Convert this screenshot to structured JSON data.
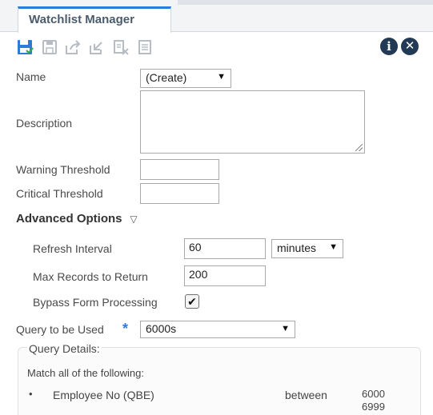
{
  "tab": {
    "label": "Watchlist Manager"
  },
  "toolbar": {
    "icons": [
      "save-icon",
      "save-as-icon",
      "export-icon",
      "import-icon",
      "delete-icon",
      "notes-icon",
      "info-icon",
      "close-icon"
    ],
    "info_glyph": "i",
    "close_glyph": "✕"
  },
  "form": {
    "name": {
      "label": "Name",
      "value": "(Create)"
    },
    "description": {
      "label": "Description",
      "value": ""
    },
    "warning_threshold": {
      "label": "Warning Threshold",
      "value": ""
    },
    "critical_threshold": {
      "label": "Critical Threshold",
      "value": ""
    }
  },
  "advanced": {
    "title": "Advanced Options",
    "toggle_glyph": "▽",
    "refresh_interval": {
      "label": "Refresh Interval",
      "value": "60",
      "unit": "minutes"
    },
    "max_records": {
      "label": "Max Records to Return",
      "value": "200"
    },
    "bypass_form": {
      "label": "Bypass Form Processing",
      "checked": true,
      "mark": "✔"
    }
  },
  "query": {
    "label": "Query to be Used",
    "required_mark": "*",
    "value": "6000s",
    "details_title": "Query Details:",
    "match_text": "Match all of the following:",
    "conditions": [
      {
        "bullet": "•",
        "field": "Employee No (QBE)",
        "operator": "between",
        "value_from": "6000",
        "value_to": "6999"
      }
    ]
  },
  "colors": {
    "accent": "#2b7dd7",
    "icon_dark": "#223a56",
    "icon_disabled": "#b7bdc5"
  }
}
